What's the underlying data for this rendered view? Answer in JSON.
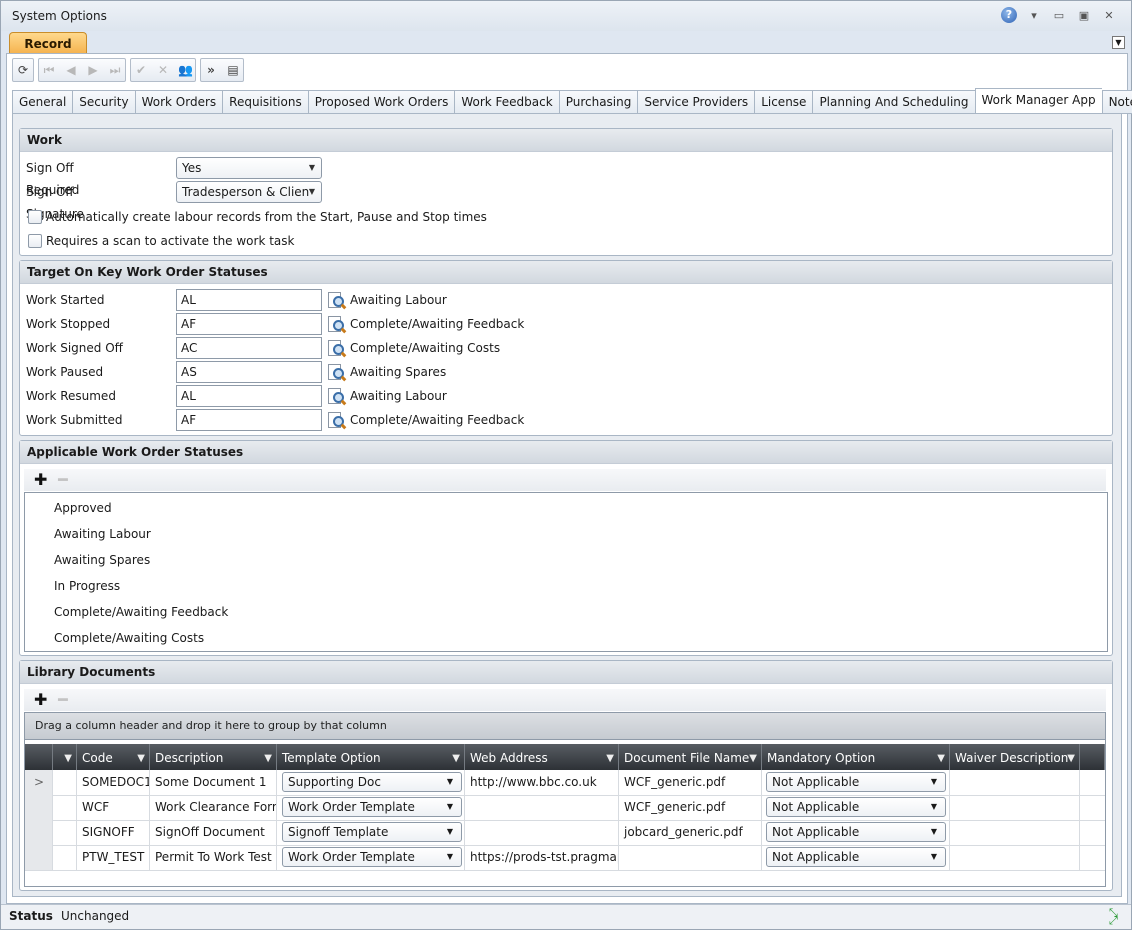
{
  "window": {
    "title": "System Options"
  },
  "ribbon": {
    "tab_label": "Record"
  },
  "tabs": [
    "General",
    "Security",
    "Work Orders",
    "Requisitions",
    "Proposed Work Orders",
    "Work Feedback",
    "Purchasing",
    "Service Providers",
    "License",
    "Planning And Scheduling",
    "Work Manager App",
    "Notes"
  ],
  "active_tab": "Work Manager App",
  "work": {
    "heading": "Work",
    "sign_off_required_label": "Sign Off Required",
    "sign_off_required_value": "Yes",
    "sign_off_signature_label": "Sign Off Signature",
    "sign_off_signature_value": "Tradesperson & Clien",
    "auto_labour_label": "Automatically create labour records from the Start, Pause and Stop times",
    "auto_labour_checked": false,
    "scan_label": "Requires a scan to activate the work task",
    "scan_checked": false
  },
  "targets": {
    "heading": "Target On Key Work Order Statuses",
    "rows": [
      {
        "label": "Work Started",
        "code": "AL",
        "desc": "Awaiting Labour"
      },
      {
        "label": "Work Stopped",
        "code": "AF",
        "desc": "Complete/Awaiting Feedback"
      },
      {
        "label": "Work Signed Off",
        "code": "AC",
        "desc": "Complete/Awaiting Costs"
      },
      {
        "label": "Work Paused",
        "code": "AS",
        "desc": "Awaiting Spares"
      },
      {
        "label": "Work Resumed",
        "code": "AL",
        "desc": "Awaiting Labour"
      },
      {
        "label": "Work Submitted",
        "code": "AF",
        "desc": "Complete/Awaiting Feedback"
      }
    ]
  },
  "applicable": {
    "heading": "Applicable Work Order Statuses",
    "items": [
      "Approved",
      "Awaiting Labour",
      "Awaiting Spares",
      "In Progress",
      "Complete/Awaiting Feedback",
      "Complete/Awaiting Costs"
    ]
  },
  "library": {
    "heading": "Library Documents",
    "group_hint": "Drag a column header and drop it here to group by that column",
    "columns": [
      "Code",
      "Description",
      "Template Option",
      "Web Address",
      "Document File Name",
      "Mandatory Option",
      "Waiver Description"
    ],
    "rows": [
      {
        "code": "SOMEDOC1",
        "description": "Some Document 1",
        "template": "Supporting Doc",
        "web": "http://www.bbc.co.uk",
        "file": "WCF_generic.pdf",
        "mandatory": "Not Applicable",
        "waiver": ""
      },
      {
        "code": "WCF",
        "description": "Work Clearance Form",
        "template": "Work Order Template",
        "web": "",
        "file": "WCF_generic.pdf",
        "mandatory": "Not Applicable",
        "waiver": ""
      },
      {
        "code": "SIGNOFF",
        "description": "SignOff Document",
        "template": "Signoff Template",
        "web": "",
        "file": "jobcard_generic.pdf",
        "mandatory": "Not Applicable",
        "waiver": ""
      },
      {
        "code": "PTW_TEST",
        "description": "Permit To Work Test",
        "template": "Work Order Template",
        "web": "https://prods-tst.pragmap",
        "file": "",
        "mandatory": "Not Applicable",
        "waiver": ""
      }
    ],
    "current_row_marker": ">"
  },
  "status": {
    "label": "Status",
    "value": "Unchanged"
  },
  "colors": {
    "ribbon_accent": "#f4b04a",
    "grid_header": "#2d3136",
    "help_icon": "#2f63b5"
  }
}
